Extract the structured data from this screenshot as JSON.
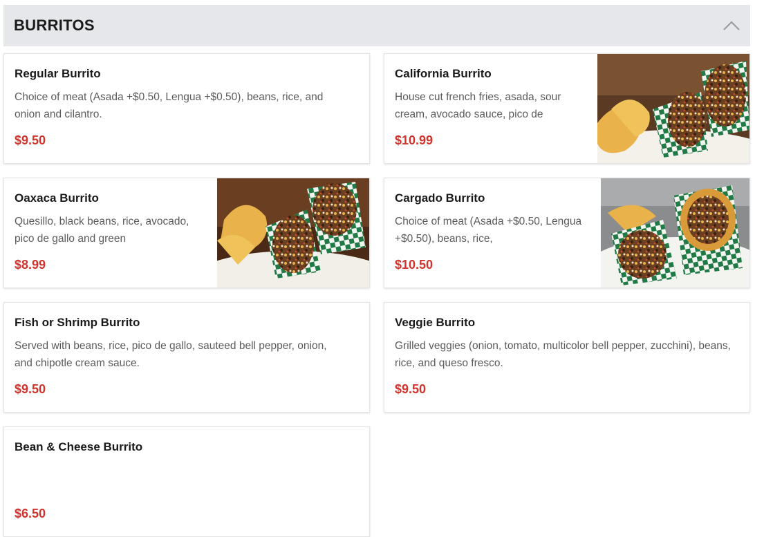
{
  "section": {
    "title": "BURRITOS",
    "collapse_icon": "chevron-up-icon"
  },
  "items": [
    {
      "name": "Regular Burrito",
      "description": "Choice of meat (Asada +$0.50, Lengua +$0.50), beans, rice, and onion and cilantro.",
      "price": "$9.50",
      "has_image": false
    },
    {
      "name": "California Burrito",
      "description": "House cut french fries, asada, sour cream, avocado sauce, pico de",
      "price": "$10.99",
      "has_image": true
    },
    {
      "name": "Oaxaca Burrito",
      "description": "Quesillo, black beans, rice, avocado, pico de gallo and green",
      "price": "$8.99",
      "has_image": true
    },
    {
      "name": "Cargado Burrito",
      "description": "Choice of meat (Asada +$0.50, Lengua +$0.50), beans, rice,",
      "price": "$10.50",
      "has_image": true
    },
    {
      "name": "Fish or Shrimp Burrito",
      "description": "Served with beans, rice, pico de gallo, sauteed bell pepper, onion, and chipotle cream sauce.",
      "price": "$9.50",
      "has_image": false
    },
    {
      "name": "Veggie Burrito",
      "description": "Grilled veggies (onion, tomato, multicolor bell pepper, zucchini), beans, rice, and queso fresco.",
      "price": "$9.50",
      "has_image": false
    },
    {
      "name": "Bean & Cheese Burrito",
      "description": "",
      "price": "$6.50",
      "has_image": false
    }
  ],
  "colors": {
    "header_bg": "#e6e7ea",
    "price": "#d0342c",
    "checker_green": "#1f7a45"
  }
}
